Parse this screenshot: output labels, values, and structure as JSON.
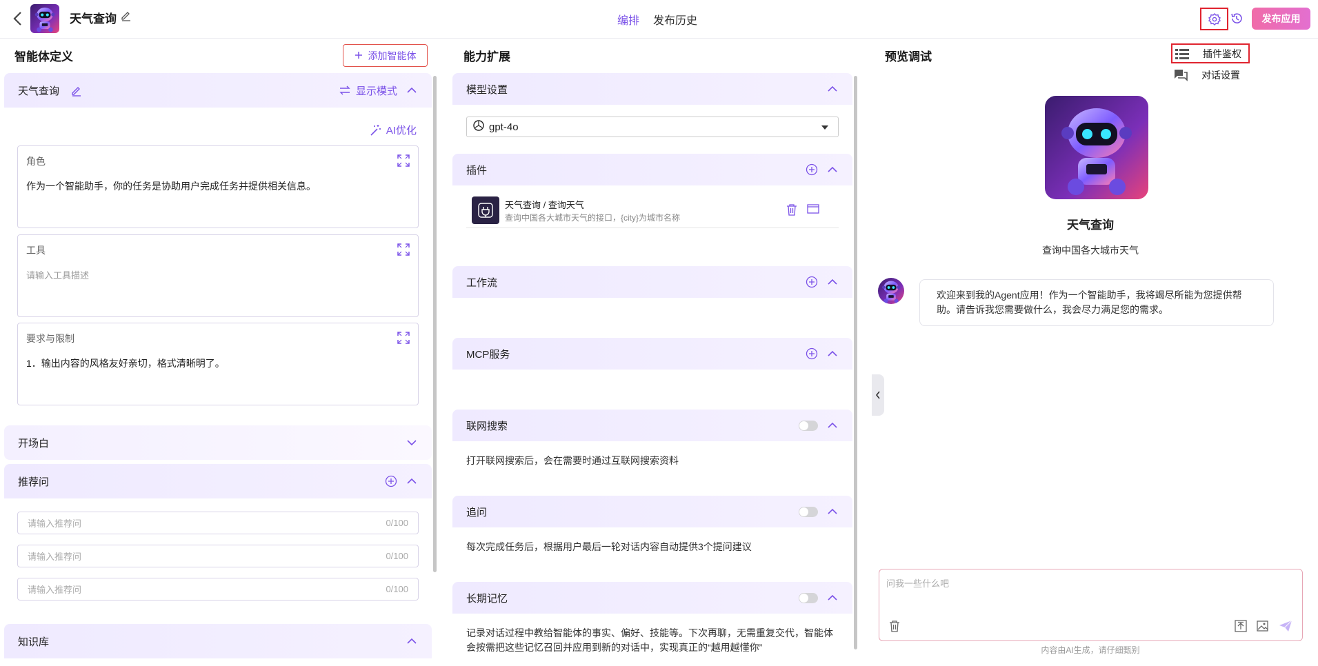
{
  "header": {
    "app_title": "天气查询",
    "tabs": [
      {
        "label": "编排",
        "active": true
      },
      {
        "label": "发布历史",
        "active": false
      }
    ],
    "publish_label": "发布应用"
  },
  "settings_menu": {
    "items": [
      {
        "label": "插件鉴权",
        "icon": "list-icon"
      },
      {
        "label": "对话设置",
        "icon": "chat-icon"
      }
    ]
  },
  "agent_definition": {
    "heading": "智能体定义",
    "add_agent_label": "添加智能体",
    "agent_name": "天气查询",
    "display_mode_label": "显示模式",
    "ai_optimize_label": "AI优化",
    "role": {
      "label": "角色",
      "value": "作为一个智能助手，你的任务是协助用户完成任务并提供相关信息。"
    },
    "tools": {
      "label": "工具",
      "placeholder": "请输入工具描述"
    },
    "constraints": {
      "label": "要求与限制",
      "value": "1．输出内容的风格友好亲切，格式清晰明了。"
    },
    "opening": {
      "label": "开场白"
    },
    "recommended": {
      "label": "推荐问",
      "inputs": [
        {
          "placeholder": "请输入推荐问",
          "counter": "0/100"
        },
        {
          "placeholder": "请输入推荐问",
          "counter": "0/100"
        },
        {
          "placeholder": "请输入推荐问",
          "counter": "0/100"
        }
      ]
    },
    "knowledge": {
      "label": "知识库"
    }
  },
  "capabilities": {
    "heading": "能力扩展",
    "model": {
      "label": "模型设置",
      "value": "gpt-4o"
    },
    "plugins": {
      "label": "插件",
      "items": [
        {
          "name": "天气查询 / 查询天气",
          "desc": "查询中国各大城市天气的接口，{city}为城市名称"
        }
      ]
    },
    "workflow": {
      "label": "工作流"
    },
    "mcp": {
      "label": "MCP服务"
    },
    "web_search": {
      "label": "联网搜索",
      "desc": "打开联网搜索后，会在需要时通过互联网搜索资料",
      "enabled": false
    },
    "follow_up": {
      "label": "追问",
      "desc": "每次完成任务后，根据用户最后一轮对话内容自动提供3个提问建议",
      "enabled": false
    },
    "memory": {
      "label": "长期记忆",
      "desc": "记录对话过程中教给智能体的事实、偏好、技能等。下次再聊，无需重复交代，智能体会按需把这些记忆召回并应用到新的对话中，实现真正的“越用越懂你”",
      "enabled": false
    }
  },
  "preview": {
    "heading": "预览调试",
    "name": "天气查询",
    "desc": "查询中国各大城市天气",
    "welcome": "欢迎来到我的Agent应用！作为一个智能助手，我将竭尽所能为您提供帮助。请告诉我您需要做什么，我会尽力满足您的需求。",
    "input_placeholder": "问我一些什么吧",
    "disclaimer": "内容由AI生成，请仔细甄别"
  },
  "colors": {
    "accent": "#7b52e8",
    "publish_gradient": [
      "#f06ca8",
      "#e36fd0"
    ],
    "highlight": "#e0242f"
  }
}
